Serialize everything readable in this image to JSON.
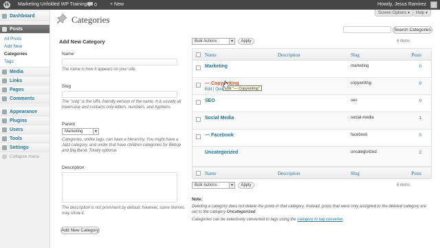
{
  "adminbar": {
    "logo": "W",
    "site_name": "Marketing Unfolded WP Training",
    "comments_count": "0",
    "new_label": "New",
    "howdy": "Howdy, Jesus Ramirez"
  },
  "screen_tabs": {
    "screen_options": "Screen Options ▾",
    "help": "Help ▾"
  },
  "sidebar": {
    "dashboard": "Dashboard",
    "posts": "Posts",
    "posts_sub": [
      "All Posts",
      "Add New",
      "Categories",
      "Tags"
    ],
    "items": [
      "Media",
      "Links",
      "Pages",
      "Comments"
    ],
    "items2": [
      "Appearance",
      "Plugins",
      "Users",
      "Tools",
      "Settings"
    ],
    "collapse": "Collapse menu"
  },
  "page": {
    "title": "Categories",
    "search_button": "Search Categories"
  },
  "form": {
    "heading": "Add New Category",
    "name_label": "Name",
    "name_help": "The name is how it appears on your site.",
    "slug_label": "Slug",
    "slug_help": "The \"slug\" is the URL-friendly version of the name. It is usually all lowercase and contains only letters, numbers, and hyphens.",
    "parent_label": "Parent",
    "parent_value": "Marketing",
    "parent_help": "Categories, unlike tags, can have a hierarchy. You might have a Jazz category, and under that have children categories for Bebop and Big Band. Totally optional.",
    "description_label": "Description",
    "description_help": "The description is not prominent by default; however, some themes may show it.",
    "submit": "Add New Category"
  },
  "table": {
    "bulk_label": "Bulk Actions",
    "apply": "Apply",
    "items_count": "6 items",
    "headers": {
      "name": "Name",
      "description": "Description",
      "slug": "Slug",
      "posts": "Posts"
    },
    "rows": [
      {
        "name": "Marketing",
        "slug": "marketing",
        "posts": "0"
      },
      {
        "name": "— Copywriting",
        "slug": "copywriting",
        "posts": "0",
        "actions": "Edit | Quick",
        "tooltip": "Edit \"— Copywriting\""
      },
      {
        "name": "SEO",
        "slug": "seo",
        "posts": "0"
      },
      {
        "name": "Social Media",
        "slug": "social-media",
        "posts": "1"
      },
      {
        "name": "— Facebook",
        "slug": "facebook",
        "posts": "0"
      },
      {
        "name": "Uncategorized",
        "slug": "uncategorized",
        "posts": "2"
      }
    ]
  },
  "notes": {
    "heading": "Note:",
    "line1": "Deleting a category does not delete the posts in that category. Instead, posts that were only assigned to the deleted category are set to the category",
    "line1_bold": "Uncategorized",
    "line2_pre": "Categories can be selectively converted to tags using the",
    "line2_link": "category to tag converter",
    "line2_post": "."
  },
  "colors": {
    "link": "#21759b",
    "adminbar": "#464646",
    "active_menu": "#6d6d6d"
  }
}
